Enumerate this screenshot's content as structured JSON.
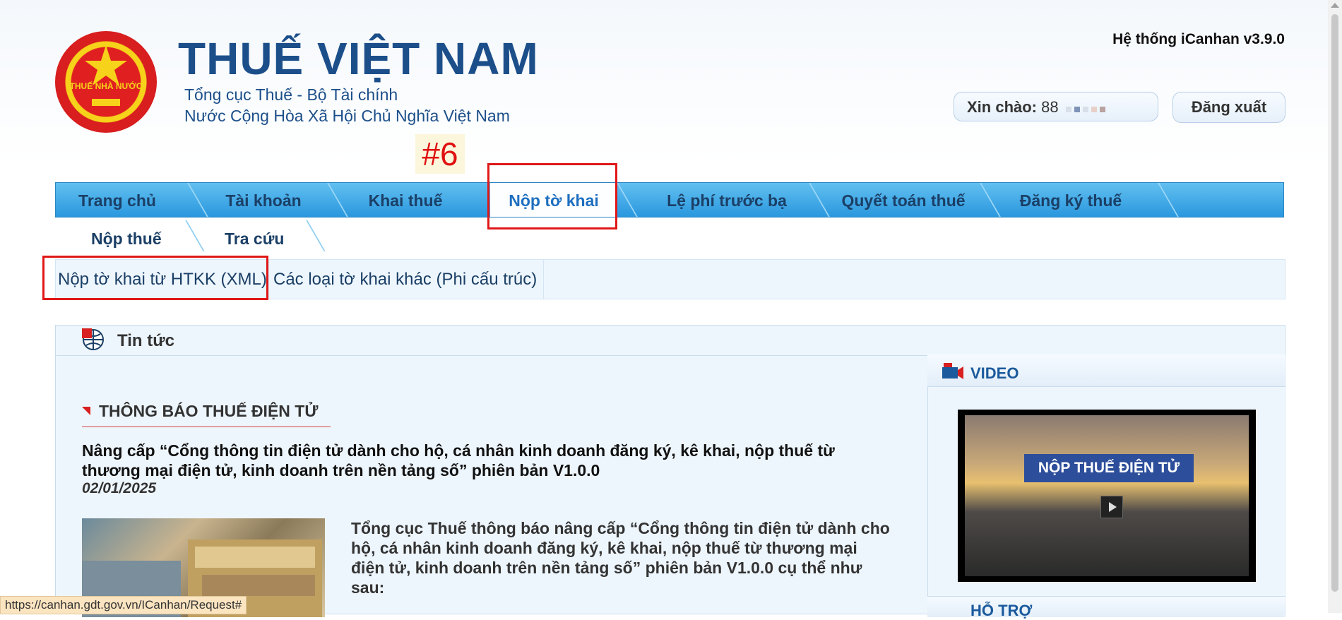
{
  "header": {
    "title": "THUẾ VIỆT NAM",
    "subtitle1": "Tổng cục Thuế - Bộ Tài chính",
    "subtitle2": "Nước Cộng Hòa Xã Hội Chủ Nghĩa Việt Nam",
    "emblem_text": "THUẾ NHÀ NƯỚC",
    "system_name": "Hệ thống iCanhan v3.9.0",
    "greeting_label": "Xin chào:",
    "greeting_user": "88",
    "logout_label": "Đăng xuất"
  },
  "annotation": {
    "step_tag": "#6"
  },
  "main_nav": [
    {
      "label": "Trang chủ"
    },
    {
      "label": "Tài khoản"
    },
    {
      "label": "Khai thuế"
    },
    {
      "label": "Nộp tờ khai",
      "active": true
    },
    {
      "label": "Lệ phí trước bạ"
    },
    {
      "label": "Quyết toán thuế"
    },
    {
      "label": "Đăng ký thuế"
    }
  ],
  "sub_nav": [
    {
      "label": "Nộp thuế"
    },
    {
      "label": "Tra cứu"
    }
  ],
  "sub_links": [
    {
      "label": "Nộp tờ khai từ HTKK (XML)"
    },
    {
      "label": "Các loại tờ khai khác (Phi cấu trúc)"
    }
  ],
  "news": {
    "section_title": "Tin tức",
    "notice_title": "THÔNG BÁO THUẾ ĐIỆN TỬ",
    "article_title": "Nâng cấp “Cổng thông tin điện tử dành cho hộ, cá nhân kinh doanh đăng ký, kê khai, nộp thuế từ thương mại điện tử, kinh doanh trên nền tảng số” phiên bản V1.0.0",
    "article_date": "02/01/2025",
    "article_body": "Tổng cục Thuế thông báo nâng cấp “Cổng thông tin điện tử dành cho hộ, cá nhân kinh doanh đăng ký, kê khai, nộp thuế từ thương mại điện tử, kinh doanh trên nền tảng số” phiên bản V1.0.0 cụ thể như sau:"
  },
  "sidebar": {
    "video_title": "VIDEO",
    "video_banner": "NỘP THUẾ ĐIỆN TỬ",
    "support_title": "HỖ TRỢ"
  },
  "status_bar": {
    "url": "https://canhan.gdt.gov.vn/ICanhan/Request#"
  },
  "colors": {
    "brand_blue": "#1c4f8a",
    "nav_blue": "#2a97de",
    "highlight_red": "#e01818"
  }
}
